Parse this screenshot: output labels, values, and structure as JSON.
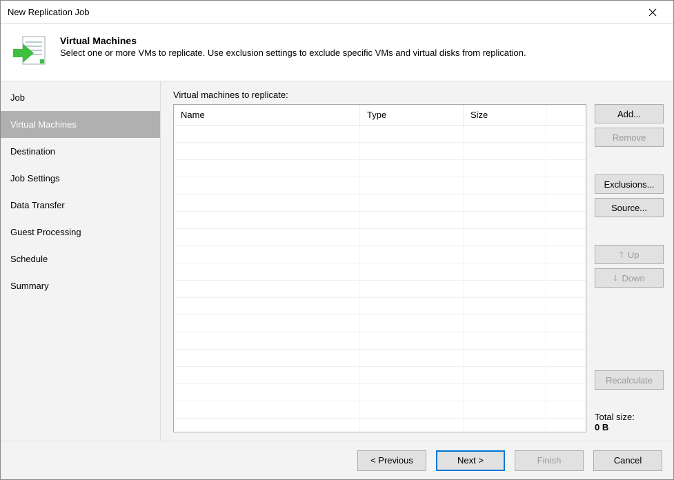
{
  "window": {
    "title": "New Replication Job"
  },
  "header": {
    "title": "Virtual Machines",
    "subtitle": "Select one or more VMs to replicate. Use exclusion settings to exclude specific VMs and virtual disks from replication."
  },
  "sidebar": {
    "items": [
      {
        "label": "Job",
        "active": false
      },
      {
        "label": "Virtual Machines",
        "active": true
      },
      {
        "label": "Destination",
        "active": false
      },
      {
        "label": "Job Settings",
        "active": false
      },
      {
        "label": "Data Transfer",
        "active": false
      },
      {
        "label": "Guest Processing",
        "active": false
      },
      {
        "label": "Schedule",
        "active": false
      },
      {
        "label": "Summary",
        "active": false
      }
    ]
  },
  "main": {
    "list_label": "Virtual machines to replicate:",
    "columns": {
      "name": "Name",
      "type": "Type",
      "size": "Size"
    },
    "rows": [],
    "empty_row_count": 18
  },
  "buttons": {
    "add": "Add...",
    "remove": "Remove",
    "exclusions": "Exclusions...",
    "source": "Source...",
    "up": "Up",
    "down": "Down",
    "recalculate": "Recalculate"
  },
  "total": {
    "label": "Total size:",
    "value": "0 B"
  },
  "footer": {
    "previous": "< Previous",
    "next": "Next >",
    "finish": "Finish",
    "cancel": "Cancel"
  }
}
